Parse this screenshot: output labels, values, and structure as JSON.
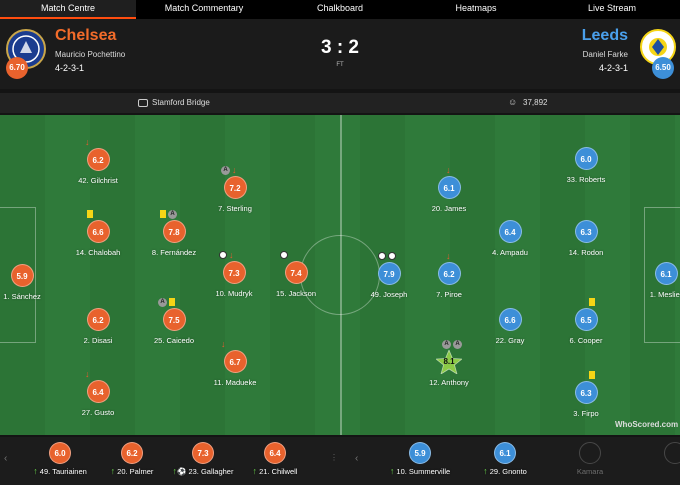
{
  "tabs": [
    "Match Centre",
    "Match Commentary",
    "Chalkboard",
    "Heatmaps",
    "Live Stream"
  ],
  "home": {
    "name": "Chelsea",
    "manager": "Mauricio Pochettino",
    "formation": "4-2-3-1",
    "rating": "6.70",
    "color": "#e8622d"
  },
  "away": {
    "name": "Leeds",
    "manager": "Daniel Farke",
    "formation": "4-2-3-1",
    "rating": "6.50",
    "color": "#3d8fd8"
  },
  "score": "3 : 2",
  "status": "FT",
  "venue": "Stamford Bridge",
  "attendance": "37,892",
  "home_players": [
    {
      "num": "42",
      "name": "Gilchrist",
      "rating": "6.2"
    },
    {
      "num": "7",
      "name": "Sterling",
      "rating": "7.2"
    },
    {
      "num": "14",
      "name": "Chalobah",
      "rating": "6.6"
    },
    {
      "num": "8",
      "name": "Fernández",
      "rating": "7.8"
    },
    {
      "num": "1",
      "name": "Sánchez",
      "rating": "5.9"
    },
    {
      "num": "10",
      "name": "Mudryk",
      "rating": "7.3"
    },
    {
      "num": "15",
      "name": "Jackson",
      "rating": "7.4"
    },
    {
      "num": "2",
      "name": "Disasi",
      "rating": "6.2"
    },
    {
      "num": "25",
      "name": "Caicedo",
      "rating": "7.5"
    },
    {
      "num": "11",
      "name": "Madueke",
      "rating": "6.7"
    },
    {
      "num": "27",
      "name": "Gusto",
      "rating": "6.4"
    }
  ],
  "away_players": [
    {
      "num": "20",
      "name": "James",
      "rating": "6.1"
    },
    {
      "num": "33",
      "name": "Roberts",
      "rating": "6.0"
    },
    {
      "num": "4",
      "name": "Ampadu",
      "rating": "6.4"
    },
    {
      "num": "14",
      "name": "Rodon",
      "rating": "6.3"
    },
    {
      "num": "49",
      "name": "Joseph",
      "rating": "7.9"
    },
    {
      "num": "7",
      "name": "Piroe",
      "rating": "6.2"
    },
    {
      "num": "1",
      "name": "Meslier",
      "rating": "6.1"
    },
    {
      "num": "22",
      "name": "Gray",
      "rating": "6.6"
    },
    {
      "num": "6",
      "name": "Cooper",
      "rating": "6.5"
    },
    {
      "num": "12",
      "name": "Anthony",
      "rating": "8.1"
    },
    {
      "num": "3",
      "name": "Firpo",
      "rating": "6.3"
    }
  ],
  "home_subs": [
    {
      "num": "49",
      "name": "Tauriainen",
      "rating": "6.0"
    },
    {
      "num": "20",
      "name": "Palmer",
      "rating": "6.2"
    },
    {
      "num": "23",
      "name": "Gallagher",
      "rating": "7.3"
    },
    {
      "num": "21",
      "name": "Chilwell",
      "rating": "6.4"
    }
  ],
  "away_subs": [
    {
      "num": "10",
      "name": "Summerville",
      "rating": "5.9"
    },
    {
      "num": "29",
      "name": "Gnonto",
      "rating": "6.1"
    },
    {
      "num": "",
      "name": "Kamara",
      "rating": ""
    },
    {
      "num": "",
      "name": "",
      "rating": ""
    }
  ],
  "watermark": "WhoScored.com"
}
